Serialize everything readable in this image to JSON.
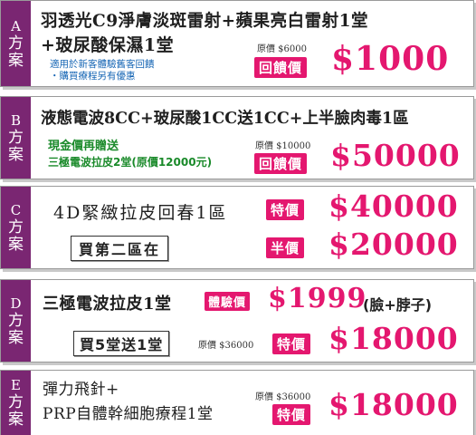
{
  "plan_a": {
    "tab_letter": "A",
    "tab_word": "方案",
    "title_line1": "羽透光C9淨膚淡斑雷射+蘋果亮白雷射1堂",
    "title_line2": "+玻尿酸保濕1堂",
    "note_line1": "適用於新客體驗舊客回饋",
    "note_line2": "・購買療程另有優惠",
    "original_price": "原價 $6000",
    "badge": "回饋價",
    "price": "$1000"
  },
  "plan_b": {
    "tab_letter": "B",
    "tab_word": "方案",
    "title": "液態電波8CC+玻尿酸1CC送1CC+上半臉肉毒1區",
    "note_line1": "現金價再贈送",
    "note_line2": "三極電波拉皮2堂(原價12000元)",
    "original_price": "原價 $10000",
    "badge": "回饋價",
    "price": "$50000"
  },
  "plan_c": {
    "tab_letter": "C",
    "tab_word": "方案",
    "title": "4D緊緻拉皮回春1區",
    "badge1": "特價",
    "price1": "$40000",
    "boxed": "買第二區在",
    "badge2": "半價",
    "price2": "$20000"
  },
  "plan_d": {
    "tab_letter": "D",
    "tab_word": "方案",
    "title": "三極電波拉皮1堂",
    "badge1": "體驗價",
    "price1": "$1999",
    "extra": "(臉+脖子)",
    "boxed": "買5堂送1堂",
    "original_price": "原價 $36000",
    "badge2": "特價",
    "price2": "$18000"
  },
  "plan_e": {
    "tab_letter": "E",
    "tab_word": "方案",
    "title_line1": "彈力飛針+",
    "title_line2": "PRP自體幹細胞療程1堂",
    "original_price": "原價 $36000",
    "badge": "特價",
    "price": "$18000"
  },
  "colors": {
    "tab": "#7a2672",
    "accent": "#e4176f",
    "note_blue": "#1565b4",
    "note_green": "#1a8a2a"
  }
}
